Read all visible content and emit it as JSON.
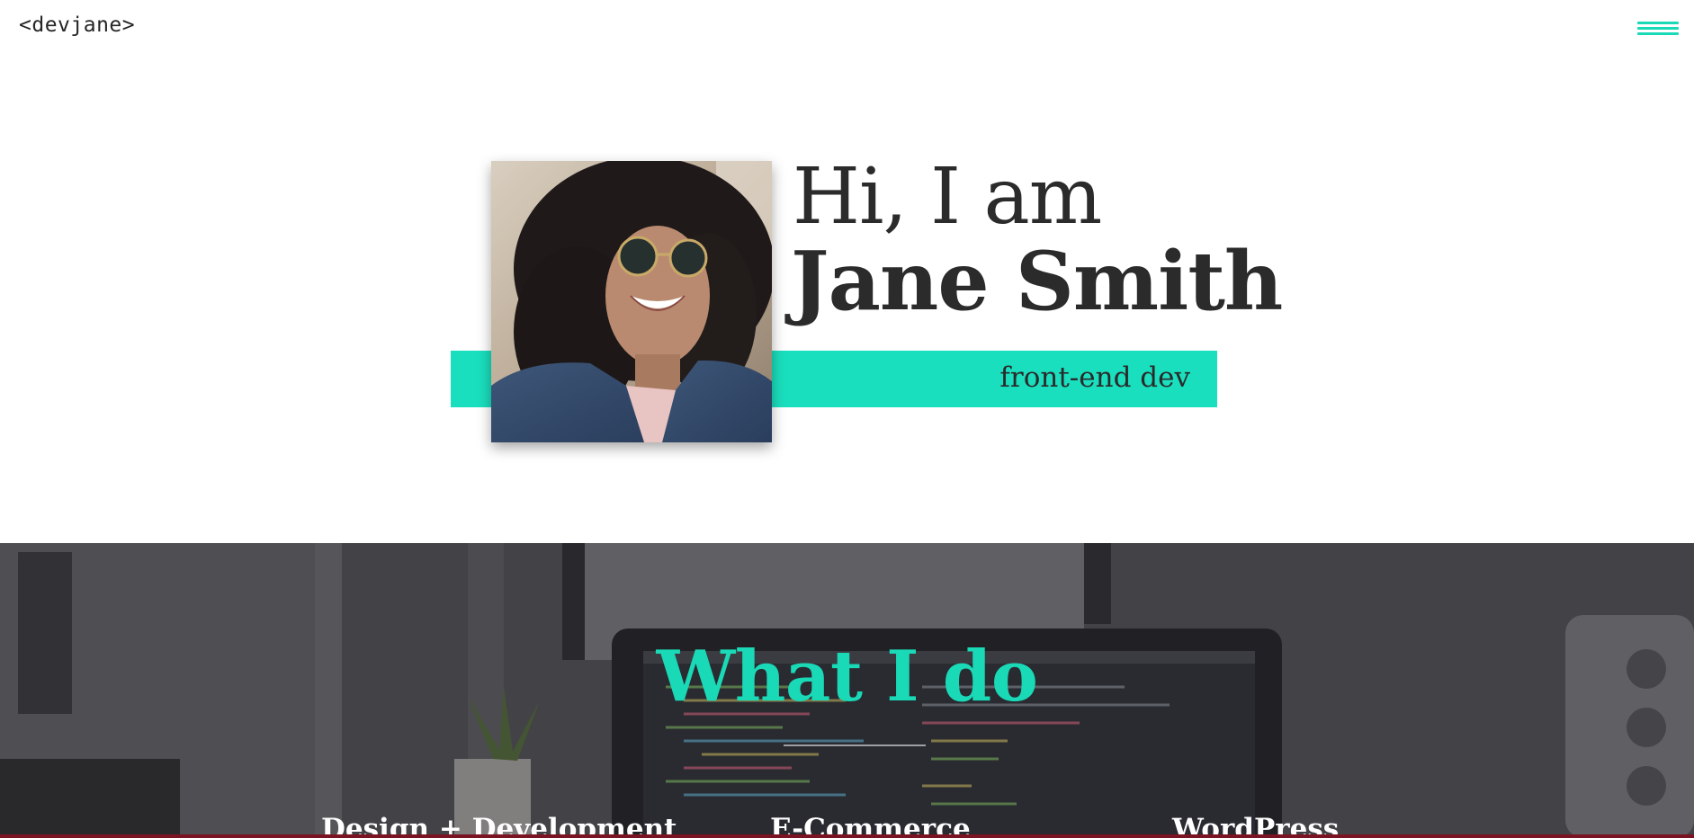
{
  "header": {
    "logo": "<devjane>",
    "menu_icon": "hamburger-menu-icon"
  },
  "hero": {
    "greeting": "Hi, I am",
    "name": "Jane Smith",
    "role": "front-end dev",
    "accent_color": "#1adfbe"
  },
  "services": {
    "title": "What I do",
    "items": [
      {
        "label": "Design + Development"
      },
      {
        "label": "E-Commerce"
      },
      {
        "label": "WordPress"
      }
    ],
    "accent_color": "#1ad9b7"
  }
}
